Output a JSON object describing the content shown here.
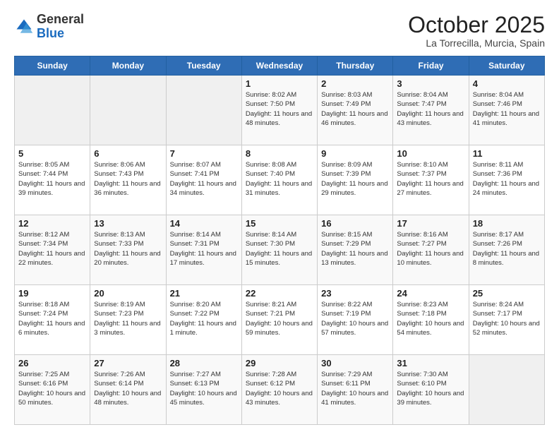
{
  "header": {
    "logo_general": "General",
    "logo_blue": "Blue",
    "month_title": "October 2025",
    "location": "La Torrecilla, Murcia, Spain"
  },
  "days_of_week": [
    "Sunday",
    "Monday",
    "Tuesday",
    "Wednesday",
    "Thursday",
    "Friday",
    "Saturday"
  ],
  "weeks": [
    [
      {
        "day": "",
        "info": ""
      },
      {
        "day": "",
        "info": ""
      },
      {
        "day": "",
        "info": ""
      },
      {
        "day": "1",
        "info": "Sunrise: 8:02 AM\nSunset: 7:50 PM\nDaylight: 11 hours and 48 minutes."
      },
      {
        "day": "2",
        "info": "Sunrise: 8:03 AM\nSunset: 7:49 PM\nDaylight: 11 hours and 46 minutes."
      },
      {
        "day": "3",
        "info": "Sunrise: 8:04 AM\nSunset: 7:47 PM\nDaylight: 11 hours and 43 minutes."
      },
      {
        "day": "4",
        "info": "Sunrise: 8:04 AM\nSunset: 7:46 PM\nDaylight: 11 hours and 41 minutes."
      }
    ],
    [
      {
        "day": "5",
        "info": "Sunrise: 8:05 AM\nSunset: 7:44 PM\nDaylight: 11 hours and 39 minutes."
      },
      {
        "day": "6",
        "info": "Sunrise: 8:06 AM\nSunset: 7:43 PM\nDaylight: 11 hours and 36 minutes."
      },
      {
        "day": "7",
        "info": "Sunrise: 8:07 AM\nSunset: 7:41 PM\nDaylight: 11 hours and 34 minutes."
      },
      {
        "day": "8",
        "info": "Sunrise: 8:08 AM\nSunset: 7:40 PM\nDaylight: 11 hours and 31 minutes."
      },
      {
        "day": "9",
        "info": "Sunrise: 8:09 AM\nSunset: 7:39 PM\nDaylight: 11 hours and 29 minutes."
      },
      {
        "day": "10",
        "info": "Sunrise: 8:10 AM\nSunset: 7:37 PM\nDaylight: 11 hours and 27 minutes."
      },
      {
        "day": "11",
        "info": "Sunrise: 8:11 AM\nSunset: 7:36 PM\nDaylight: 11 hours and 24 minutes."
      }
    ],
    [
      {
        "day": "12",
        "info": "Sunrise: 8:12 AM\nSunset: 7:34 PM\nDaylight: 11 hours and 22 minutes."
      },
      {
        "day": "13",
        "info": "Sunrise: 8:13 AM\nSunset: 7:33 PM\nDaylight: 11 hours and 20 minutes."
      },
      {
        "day": "14",
        "info": "Sunrise: 8:14 AM\nSunset: 7:31 PM\nDaylight: 11 hours and 17 minutes."
      },
      {
        "day": "15",
        "info": "Sunrise: 8:14 AM\nSunset: 7:30 PM\nDaylight: 11 hours and 15 minutes."
      },
      {
        "day": "16",
        "info": "Sunrise: 8:15 AM\nSunset: 7:29 PM\nDaylight: 11 hours and 13 minutes."
      },
      {
        "day": "17",
        "info": "Sunrise: 8:16 AM\nSunset: 7:27 PM\nDaylight: 11 hours and 10 minutes."
      },
      {
        "day": "18",
        "info": "Sunrise: 8:17 AM\nSunset: 7:26 PM\nDaylight: 11 hours and 8 minutes."
      }
    ],
    [
      {
        "day": "19",
        "info": "Sunrise: 8:18 AM\nSunset: 7:24 PM\nDaylight: 11 hours and 6 minutes."
      },
      {
        "day": "20",
        "info": "Sunrise: 8:19 AM\nSunset: 7:23 PM\nDaylight: 11 hours and 3 minutes."
      },
      {
        "day": "21",
        "info": "Sunrise: 8:20 AM\nSunset: 7:22 PM\nDaylight: 11 hours and 1 minute."
      },
      {
        "day": "22",
        "info": "Sunrise: 8:21 AM\nSunset: 7:21 PM\nDaylight: 10 hours and 59 minutes."
      },
      {
        "day": "23",
        "info": "Sunrise: 8:22 AM\nSunset: 7:19 PM\nDaylight: 10 hours and 57 minutes."
      },
      {
        "day": "24",
        "info": "Sunrise: 8:23 AM\nSunset: 7:18 PM\nDaylight: 10 hours and 54 minutes."
      },
      {
        "day": "25",
        "info": "Sunrise: 8:24 AM\nSunset: 7:17 PM\nDaylight: 10 hours and 52 minutes."
      }
    ],
    [
      {
        "day": "26",
        "info": "Sunrise: 7:25 AM\nSunset: 6:16 PM\nDaylight: 10 hours and 50 minutes."
      },
      {
        "day": "27",
        "info": "Sunrise: 7:26 AM\nSunset: 6:14 PM\nDaylight: 10 hours and 48 minutes."
      },
      {
        "day": "28",
        "info": "Sunrise: 7:27 AM\nSunset: 6:13 PM\nDaylight: 10 hours and 45 minutes."
      },
      {
        "day": "29",
        "info": "Sunrise: 7:28 AM\nSunset: 6:12 PM\nDaylight: 10 hours and 43 minutes."
      },
      {
        "day": "30",
        "info": "Sunrise: 7:29 AM\nSunset: 6:11 PM\nDaylight: 10 hours and 41 minutes."
      },
      {
        "day": "31",
        "info": "Sunrise: 7:30 AM\nSunset: 6:10 PM\nDaylight: 10 hours and 39 minutes."
      },
      {
        "day": "",
        "info": ""
      }
    ]
  ]
}
